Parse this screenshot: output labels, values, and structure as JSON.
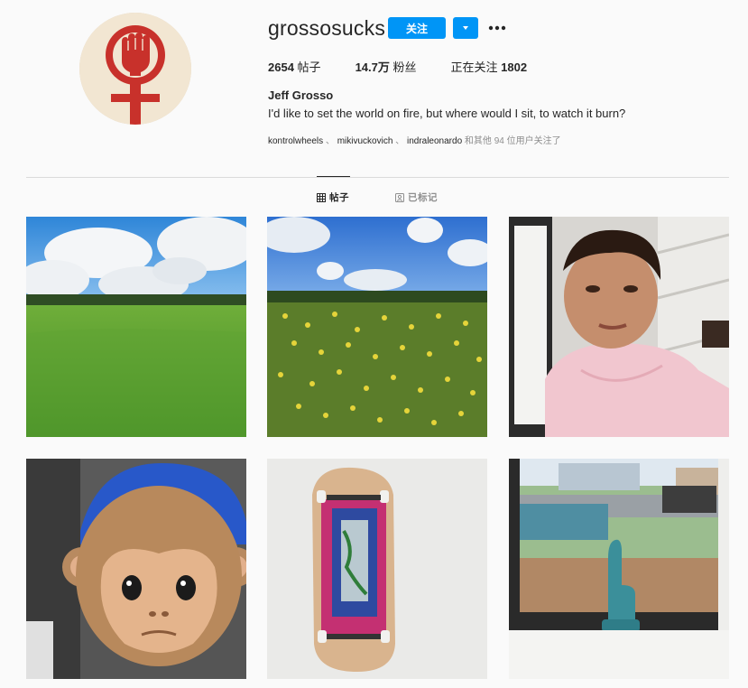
{
  "profile": {
    "username": "grossosucks",
    "follow_label": "关注",
    "stats": [
      {
        "value": "2654",
        "label": "帖子"
      },
      {
        "value": "14.7万",
        "label": "粉丝"
      },
      {
        "label": "正在关注",
        "value": "1802"
      }
    ],
    "full_name": "Jeff Grosso",
    "bio": "I'd like to set the world on fire, but where would I sit, to watch it burn?",
    "followed_by": {
      "accounts": [
        "kontrolwheels",
        "mikivuckovich",
        "indraleonardo"
      ],
      "suffix": "和其他 94 位用户关注了"
    }
  },
  "tabs": [
    {
      "label": "帖子",
      "icon": "grid-icon",
      "active": true
    },
    {
      "label": "已标记",
      "icon": "tagged-icon",
      "active": false
    }
  ],
  "posts": [
    {
      "subject": "green field with cloudy blue sky"
    },
    {
      "subject": "yellow wildflower field with blue sky"
    },
    {
      "subject": "boy in pink hoodie selfie"
    },
    {
      "subject": "monkey animoji with blue beanie"
    },
    {
      "subject": "fingerboard skateboard"
    },
    {
      "subject": "middle finger statue on window sill"
    }
  ],
  "colors": {
    "accent": "#0095f6",
    "logo_red": "#c8312b"
  }
}
